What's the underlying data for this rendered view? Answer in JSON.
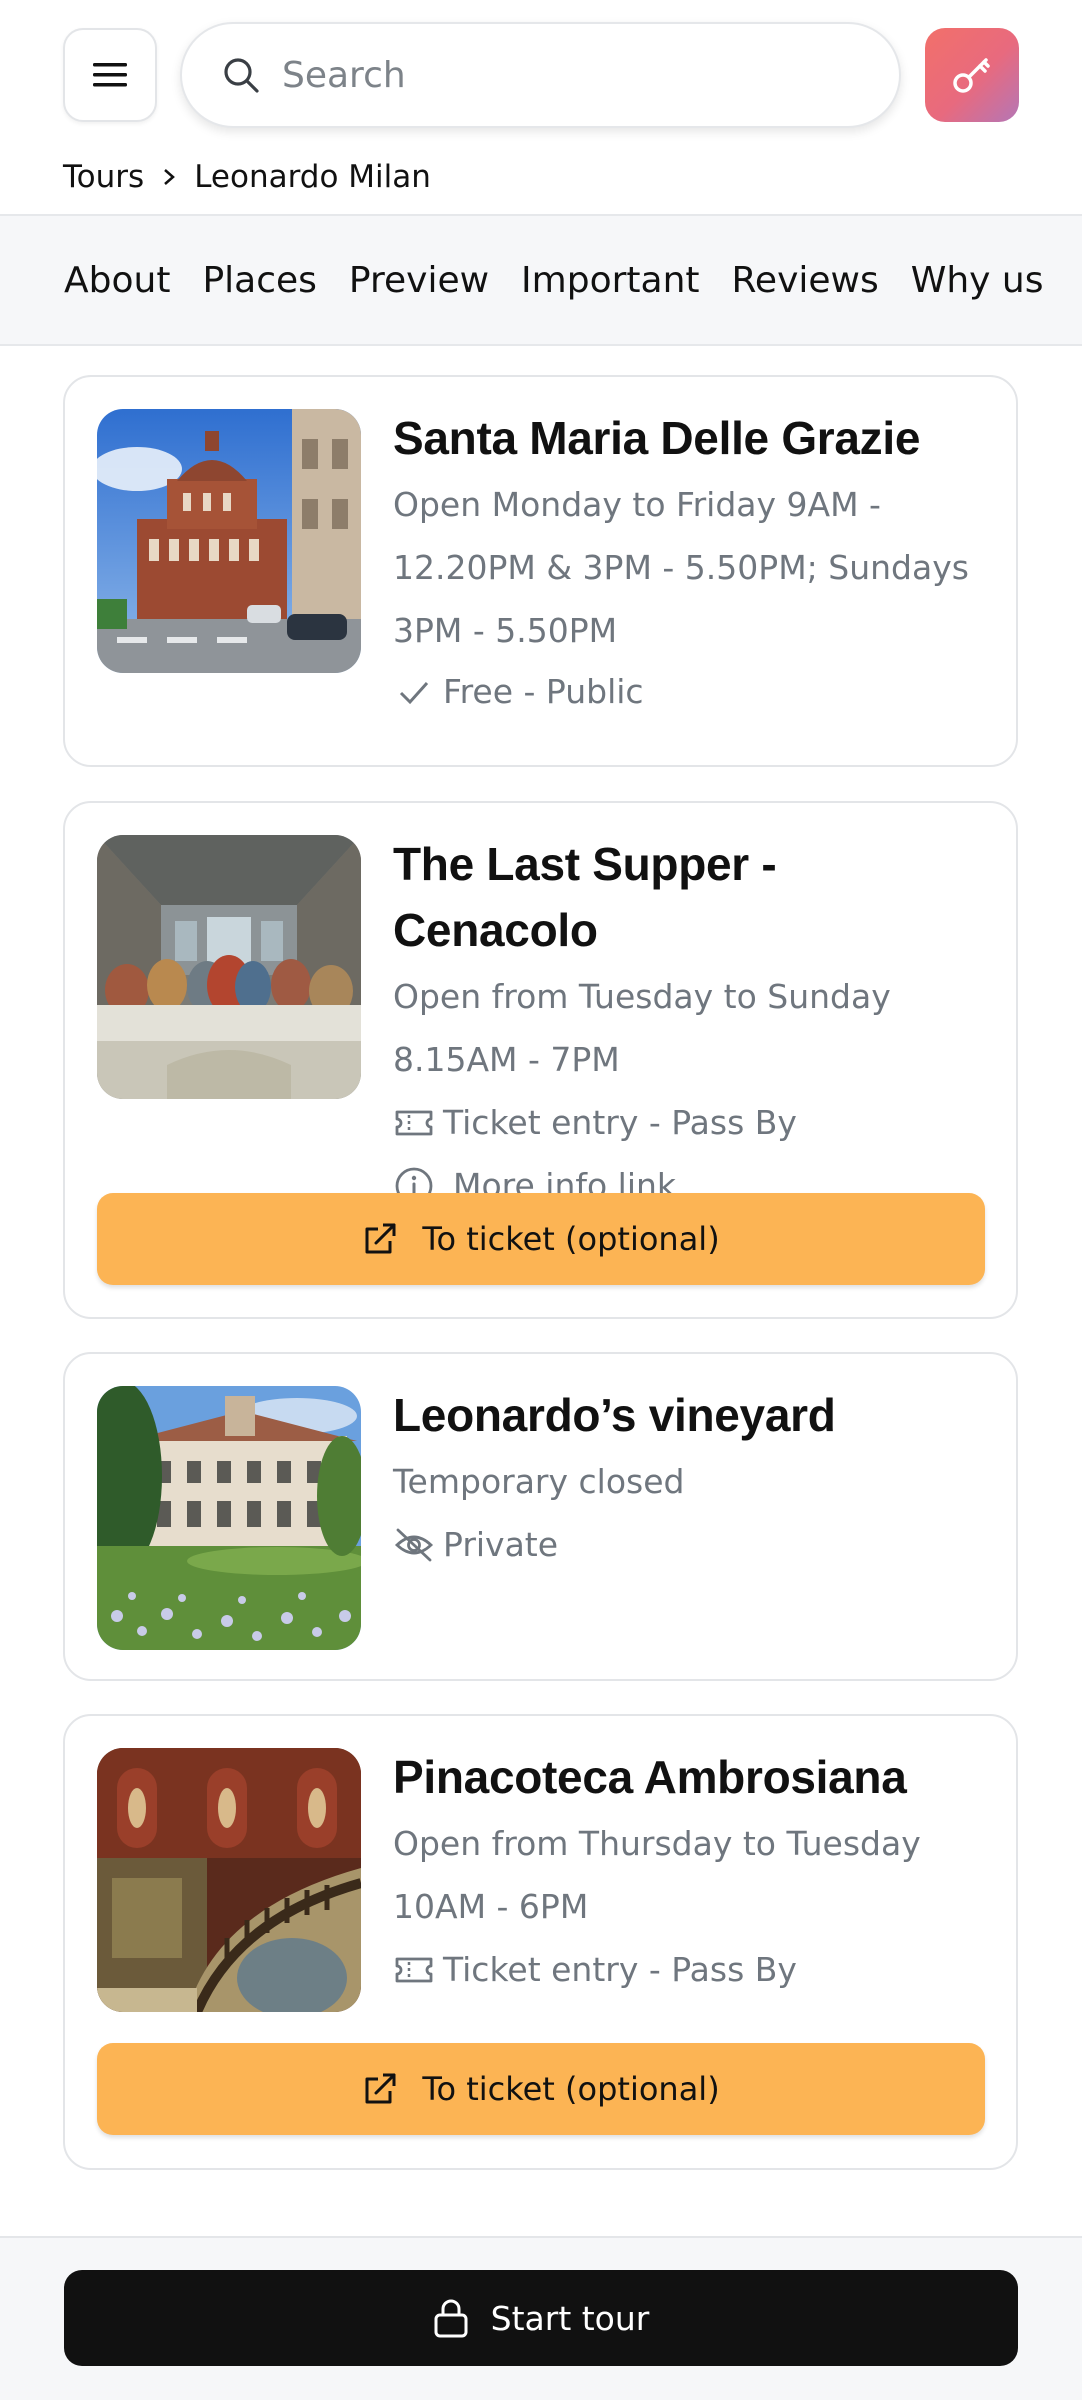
{
  "header": {
    "search_placeholder": "Search",
    "icons": {
      "menu": "hamburger-menu-icon",
      "search": "search-icon",
      "key": "key-icon"
    },
    "key_button_gradient": [
      "#f2706a",
      "#b476b6"
    ]
  },
  "breadcrumb": {
    "root": "Tours",
    "current": "Leonardo Milan"
  },
  "tabs": [
    "About",
    "Places",
    "Preview",
    "Important",
    "Reviews",
    "Why us"
  ],
  "places": [
    {
      "title": "Santa Maria Delle Grazie",
      "hours_line1": "Open Monday to Friday 9AM -",
      "hours_line2": "12.20PM & 3PM - 5.50PM; Sundays",
      "hours_line3": "3PM - 5.50PM",
      "access": "Free - Public",
      "access_icon": "check-icon"
    },
    {
      "title": "The Last Supper - Cenacolo",
      "hours_line1": "Open from Tuesday to Sunday",
      "hours_line2": "8.15AM - 7PM",
      "access": "Ticket entry - Pass By",
      "access_icon": "ticket-icon",
      "info_link": "More info link",
      "cta": "To ticket (optional)"
    },
    {
      "title": "Leonardo’s vineyard",
      "hours_line1": "Temporary closed",
      "access": "Private",
      "access_icon": "eye-off-icon"
    },
    {
      "title": "Pinacoteca Ambrosiana",
      "hours_line1": "Open from Thursday to Tuesday",
      "hours_line2": "10AM - 6PM",
      "access": "Ticket entry - Pass By",
      "access_icon": "ticket-icon",
      "cta": "To ticket (optional)"
    }
  ],
  "footer": {
    "start_label": "Start tour",
    "icon": "lock-icon"
  },
  "colors": {
    "cta": "#fcb454",
    "start_button": "#111111",
    "muted_text": "#6f767e",
    "tab_bar": "#f6f7f9"
  }
}
